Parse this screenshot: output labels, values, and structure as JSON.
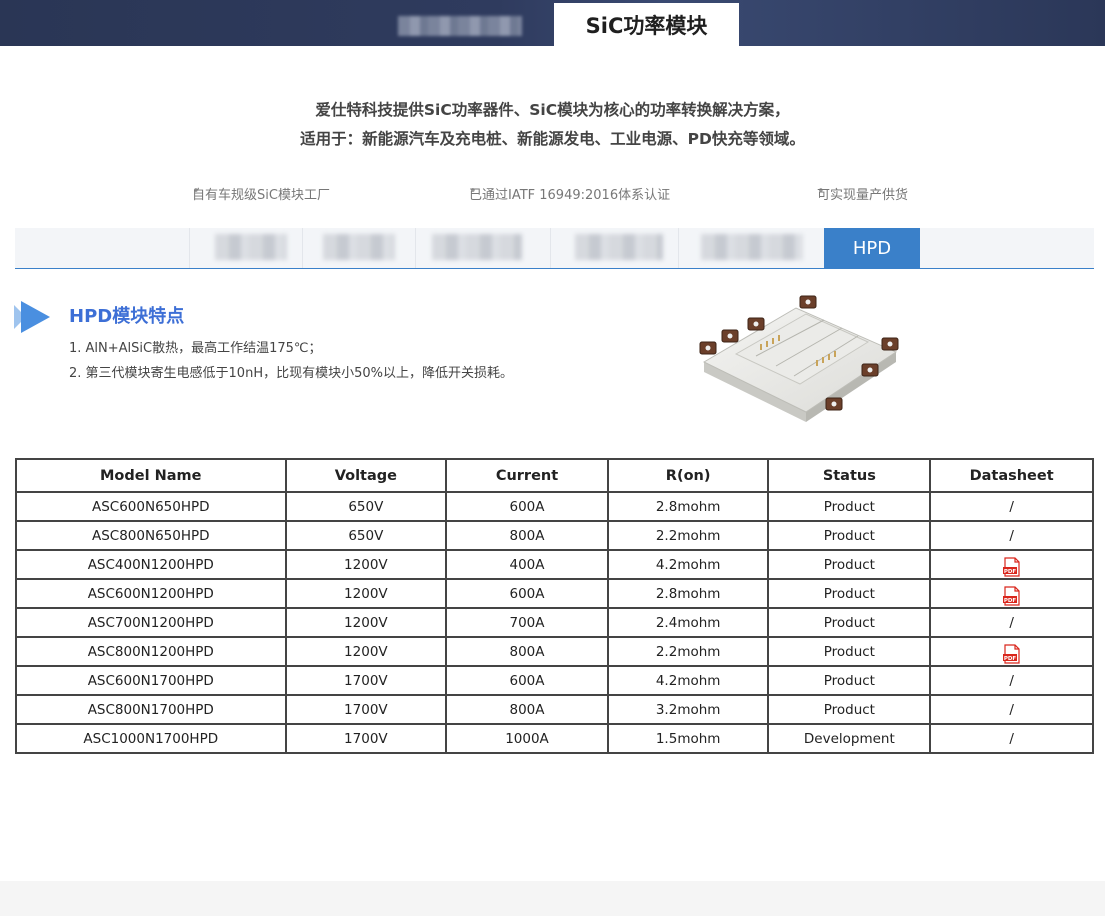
{
  "header": {
    "active_tab": "SiC功率模块"
  },
  "intro": {
    "line1": "爱仕特科技提供SiC功率器件、SiC模块为核心的功率转换解决方案，",
    "line2": "适用于：新能源汽车及充电桩、新能源发电、工业电源、PD快充等领域。"
  },
  "features": [
    "自有车规级SiC模块工厂",
    "已通过IATF 16949:2016体系认证",
    "可实现量产供货"
  ],
  "tabs": {
    "active_label": "HPD"
  },
  "section": {
    "title": "HPD模块特点",
    "points": [
      "1. AlN+AlSiC散热，最高工作结温175℃；",
      "2. 第三代模块寄生电感低于10nH，比现有模块小50%以上，降低开关损耗。"
    ]
  },
  "table": {
    "headers": [
      "Model Name",
      "Voltage",
      "Current",
      "R(on)",
      "Status",
      "Datasheet"
    ],
    "rows": [
      [
        "ASC600N650HPD",
        "650V",
        "600A",
        "2.8mohm",
        "Product",
        "/"
      ],
      [
        "ASC800N650HPD",
        "650V",
        "800A",
        "2.2mohm",
        "Product",
        "/"
      ],
      [
        "ASC400N1200HPD",
        "1200V",
        "400A",
        "4.2mohm",
        "Product",
        "pdf"
      ],
      [
        "ASC600N1200HPD",
        "1200V",
        "600A",
        "2.8mohm",
        "Product",
        "pdf"
      ],
      [
        "ASC700N1200HPD",
        "1200V",
        "700A",
        "2.4mohm",
        "Product",
        "/"
      ],
      [
        "ASC800N1200HPD",
        "1200V",
        "800A",
        "2.2mohm",
        "Product",
        "pdf"
      ],
      [
        "ASC600N1700HPD",
        "1700V",
        "600A",
        "4.2mohm",
        "Product",
        "/"
      ],
      [
        "ASC800N1700HPD",
        "1700V",
        "800A",
        "3.2mohm",
        "Product",
        "/"
      ],
      [
        "ASC1000N1700HPD",
        "1700V",
        "1000A",
        "1.5mohm",
        "Development",
        "/"
      ]
    ]
  },
  "colors": {
    "accent": "#3a80c9",
    "title_blue": "#3d6fd6",
    "header_bg": "#2f3b5e",
    "pdf_red": "#d9261c"
  }
}
